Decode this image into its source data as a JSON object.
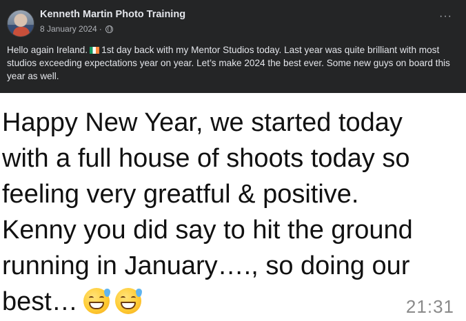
{
  "post": {
    "author": "Kenneth Martin Photo Training",
    "date": "8 January 2024",
    "separator": "·",
    "more_label": "···",
    "text_before_flag": "Hello again Ireland.",
    "text_after_flag": "1st day back with my Mentor Studios today. Last year was quite brilliant with most studios exceeding expectations year on year. Let’s make 2024 the best ever. Some new guys on board this year as well.",
    "icons": {
      "avatar": "profile-photo",
      "privacy": "globe-icon",
      "flag": "ireland-flag-icon",
      "more": "more-options-icon"
    },
    "colors": {
      "background": "#242526",
      "text": "#e4e6eb",
      "secondary": "#b0b3b8"
    }
  },
  "message": {
    "lines": [
      "Happy New Year, we started today",
      "with a full house of shoots today  so",
      "feeling very greatful & positive.",
      "Kenny you did say to hit the ground",
      "running in January…., so doing our",
      "best…"
    ],
    "emoji": [
      "grinning-face-with-sweat-icon",
      "grinning-face-with-sweat-icon"
    ],
    "time": "21:31"
  }
}
